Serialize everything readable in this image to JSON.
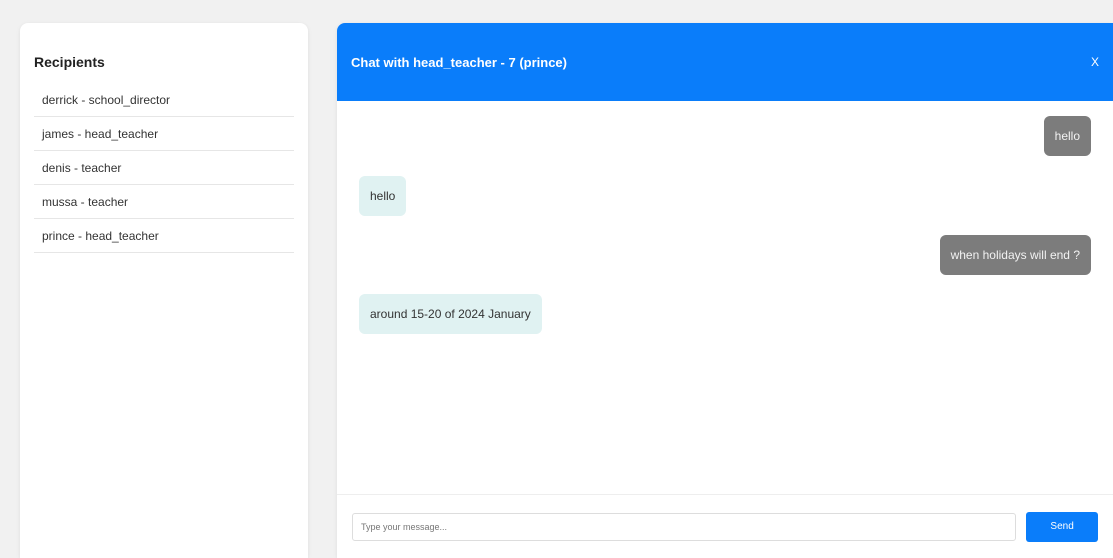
{
  "sidebar": {
    "title": "Recipients",
    "recipients": [
      {
        "label": "derrick - school_director"
      },
      {
        "label": "james - head_teacher"
      },
      {
        "label": "denis - teacher"
      },
      {
        "label": "mussa - teacher"
      },
      {
        "label": "prince - head_teacher"
      }
    ]
  },
  "chat": {
    "title": "Chat with head_teacher - 7 (prince)",
    "close_label": "X",
    "messages": [
      {
        "text": "hello",
        "direction": "sent"
      },
      {
        "text": "hello",
        "direction": "received"
      },
      {
        "text": "when holidays will end ?",
        "direction": "sent"
      },
      {
        "text": "around 15-20 of 2024 January",
        "direction": "received"
      }
    ],
    "input": {
      "value": "",
      "placeholder": "Type your message..."
    },
    "send_label": "Send"
  },
  "colors": {
    "accent": "#0a7dfa",
    "sent_bubble": "#7c7c7c",
    "received_bubble": "#e0f2f2",
    "background": "#f1f1f1"
  }
}
